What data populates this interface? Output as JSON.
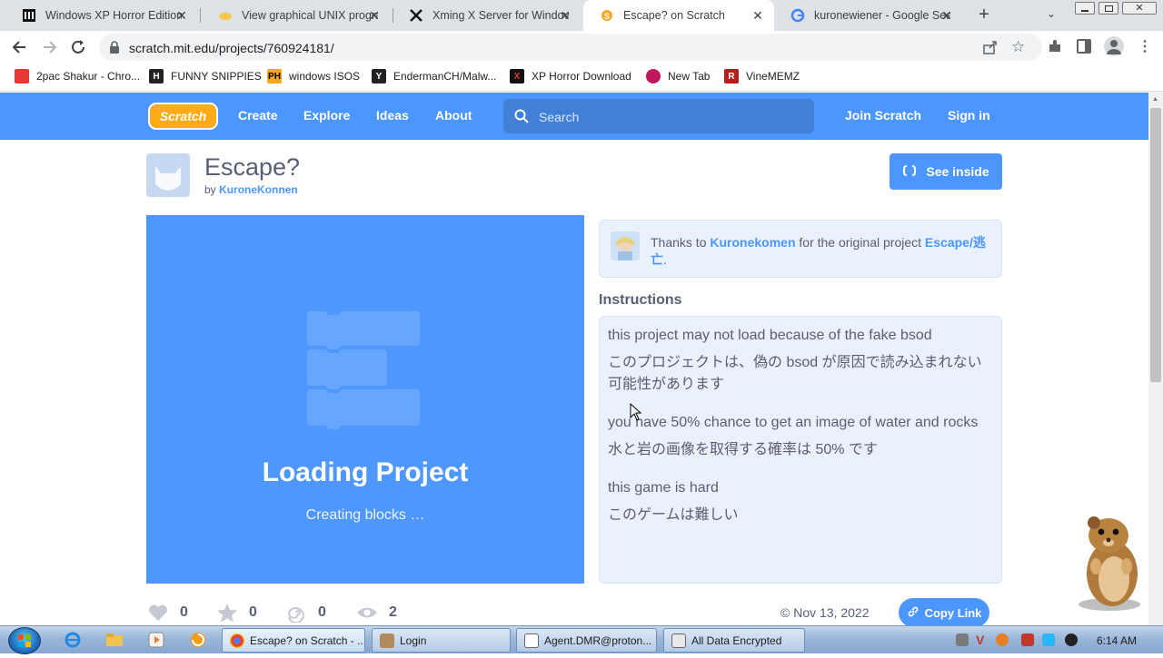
{
  "browser": {
    "tabs": [
      {
        "title": "Windows XP Horror Edition",
        "favicon": "archive-icon",
        "active": false
      },
      {
        "title": "View graphical UNIX progra",
        "favicon": "hand-icon",
        "active": false
      },
      {
        "title": "Xming X Server for Windov",
        "favicon": "x-icon",
        "active": false
      },
      {
        "title": "Escape? on Scratch",
        "favicon": "scratch-icon",
        "active": true
      },
      {
        "title": "kuronewiener - Google Sea",
        "favicon": "google-icon",
        "active": false
      }
    ],
    "new_tab": "+",
    "url": "scratch.mit.edu/projects/760924181/",
    "bookmarks": [
      {
        "label": "2pac Shakur - Chro...",
        "color": "#e53935"
      },
      {
        "label": "FUNNY SNIPPIES",
        "color": "#222222"
      },
      {
        "label": "windows ISOS",
        "color": "#f5a623"
      },
      {
        "label": "EndermanCH/Malw...",
        "color": "#222222"
      },
      {
        "label": "XP Horror Download",
        "color": "#111111"
      },
      {
        "label": "New Tab",
        "color": "#c2185b"
      },
      {
        "label": "VineMEMZ",
        "color": "#b71c1c"
      }
    ]
  },
  "scratch": {
    "logo": "Scratch",
    "nav": {
      "create": "Create",
      "explore": "Explore",
      "ideas": "Ideas",
      "about": "About",
      "search_placeholder": "Search",
      "join": "Join Scratch",
      "signin": "Sign in"
    },
    "project": {
      "title": "Escape?",
      "by": "by",
      "author": "KuroneKonnen",
      "see_inside": "See inside",
      "loading_title": "Loading Project",
      "loading_sub": "Creating blocks …",
      "credit_prefix": "Thanks to",
      "credit_user": "Kuronekomen",
      "credit_mid": "for the original project",
      "credit_project": "Escape/逃亡",
      "credit_suffix": ".",
      "instructions_heading": "Instructions",
      "instructions": [
        "this project may not load because of the fake bsod",
        "このプロジェクトは、偽の bsod が原因で読み込まれない",
        "可能性があります",
        "",
        "you have 50% chance to get an image of water and rocks",
        "水と岩の画像を取得する確率は 50% です",
        "",
        "this game is hard",
        "このゲームは難しい"
      ],
      "stats": {
        "loves": "0",
        "favorites": "0",
        "remixes": "0",
        "views": "2"
      },
      "date": "© Nov 13, 2022",
      "copy_link": "Copy Link"
    }
  },
  "taskbar": {
    "items": [
      {
        "label": "Escape? on Scratch - ...",
        "active": true
      },
      {
        "label": "Login",
        "active": false
      },
      {
        "label": "Agent.DMR@proton...",
        "active": false
      },
      {
        "label": "All Data Encrypted",
        "active": false
      }
    ],
    "clock": "6:14 AM"
  },
  "colors": {
    "scratch_blue": "#4c97ff",
    "text": "#575e75",
    "panel": "#e9f1fc"
  }
}
